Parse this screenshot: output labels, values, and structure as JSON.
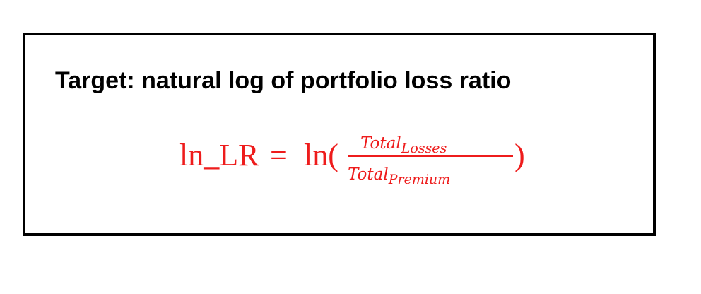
{
  "heading": "Target: natural log of portfolio loss ratio",
  "formula": {
    "lhs": "ln_LR",
    "equals": "=",
    "func": "ln(",
    "numerator_base": "Total",
    "numerator_sub": "Losses",
    "denominator_base": "Total",
    "denominator_sub": "Premium",
    "close": ")",
    "color": "#ee1c1c"
  }
}
